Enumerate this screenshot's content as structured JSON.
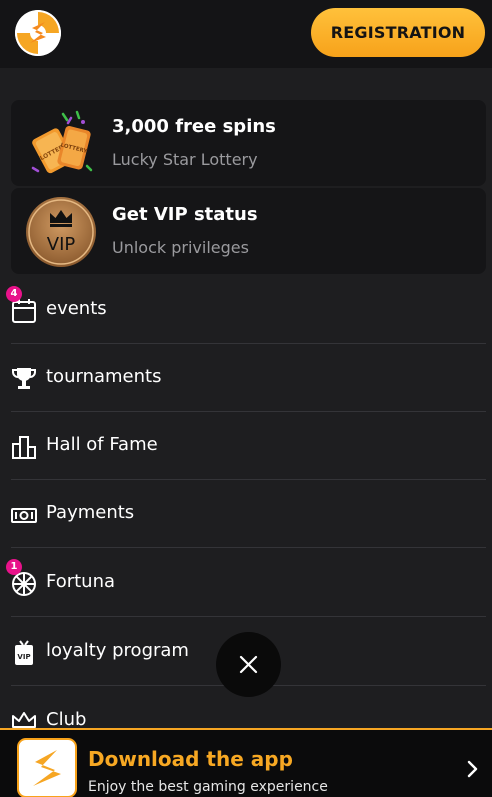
{
  "header": {
    "registration_label": "REGISTRATION"
  },
  "promos": [
    {
      "title": "3,000 free spins",
      "subtitle": "Lucky Star Lottery",
      "icon": "lottery-tickets-icon"
    },
    {
      "title": "Get VIP status",
      "subtitle": "Unlock privileges",
      "icon": "vip-crown-icon",
      "icon_text": "VIP"
    }
  ],
  "menu": [
    {
      "label": "events",
      "icon": "calendar-icon",
      "badge": "4"
    },
    {
      "label": "tournaments",
      "icon": "trophy-icon"
    },
    {
      "label": "Hall of Fame",
      "icon": "podium-icon"
    },
    {
      "label": "Payments",
      "icon": "cash-icon"
    },
    {
      "label": "Fortuna",
      "icon": "wheel-icon",
      "badge": "1"
    },
    {
      "label": "loyalty program",
      "icon": "vip-card-icon"
    },
    {
      "label": "Club",
      "icon": "crown-icon"
    }
  ],
  "app_banner": {
    "title": "Download the app",
    "subtitle": "Enjoy the best gaming experience"
  },
  "colors": {
    "accent": "#f7a21a",
    "badge": "#e8128a",
    "background": "#1e1e20",
    "header": "#141416"
  }
}
